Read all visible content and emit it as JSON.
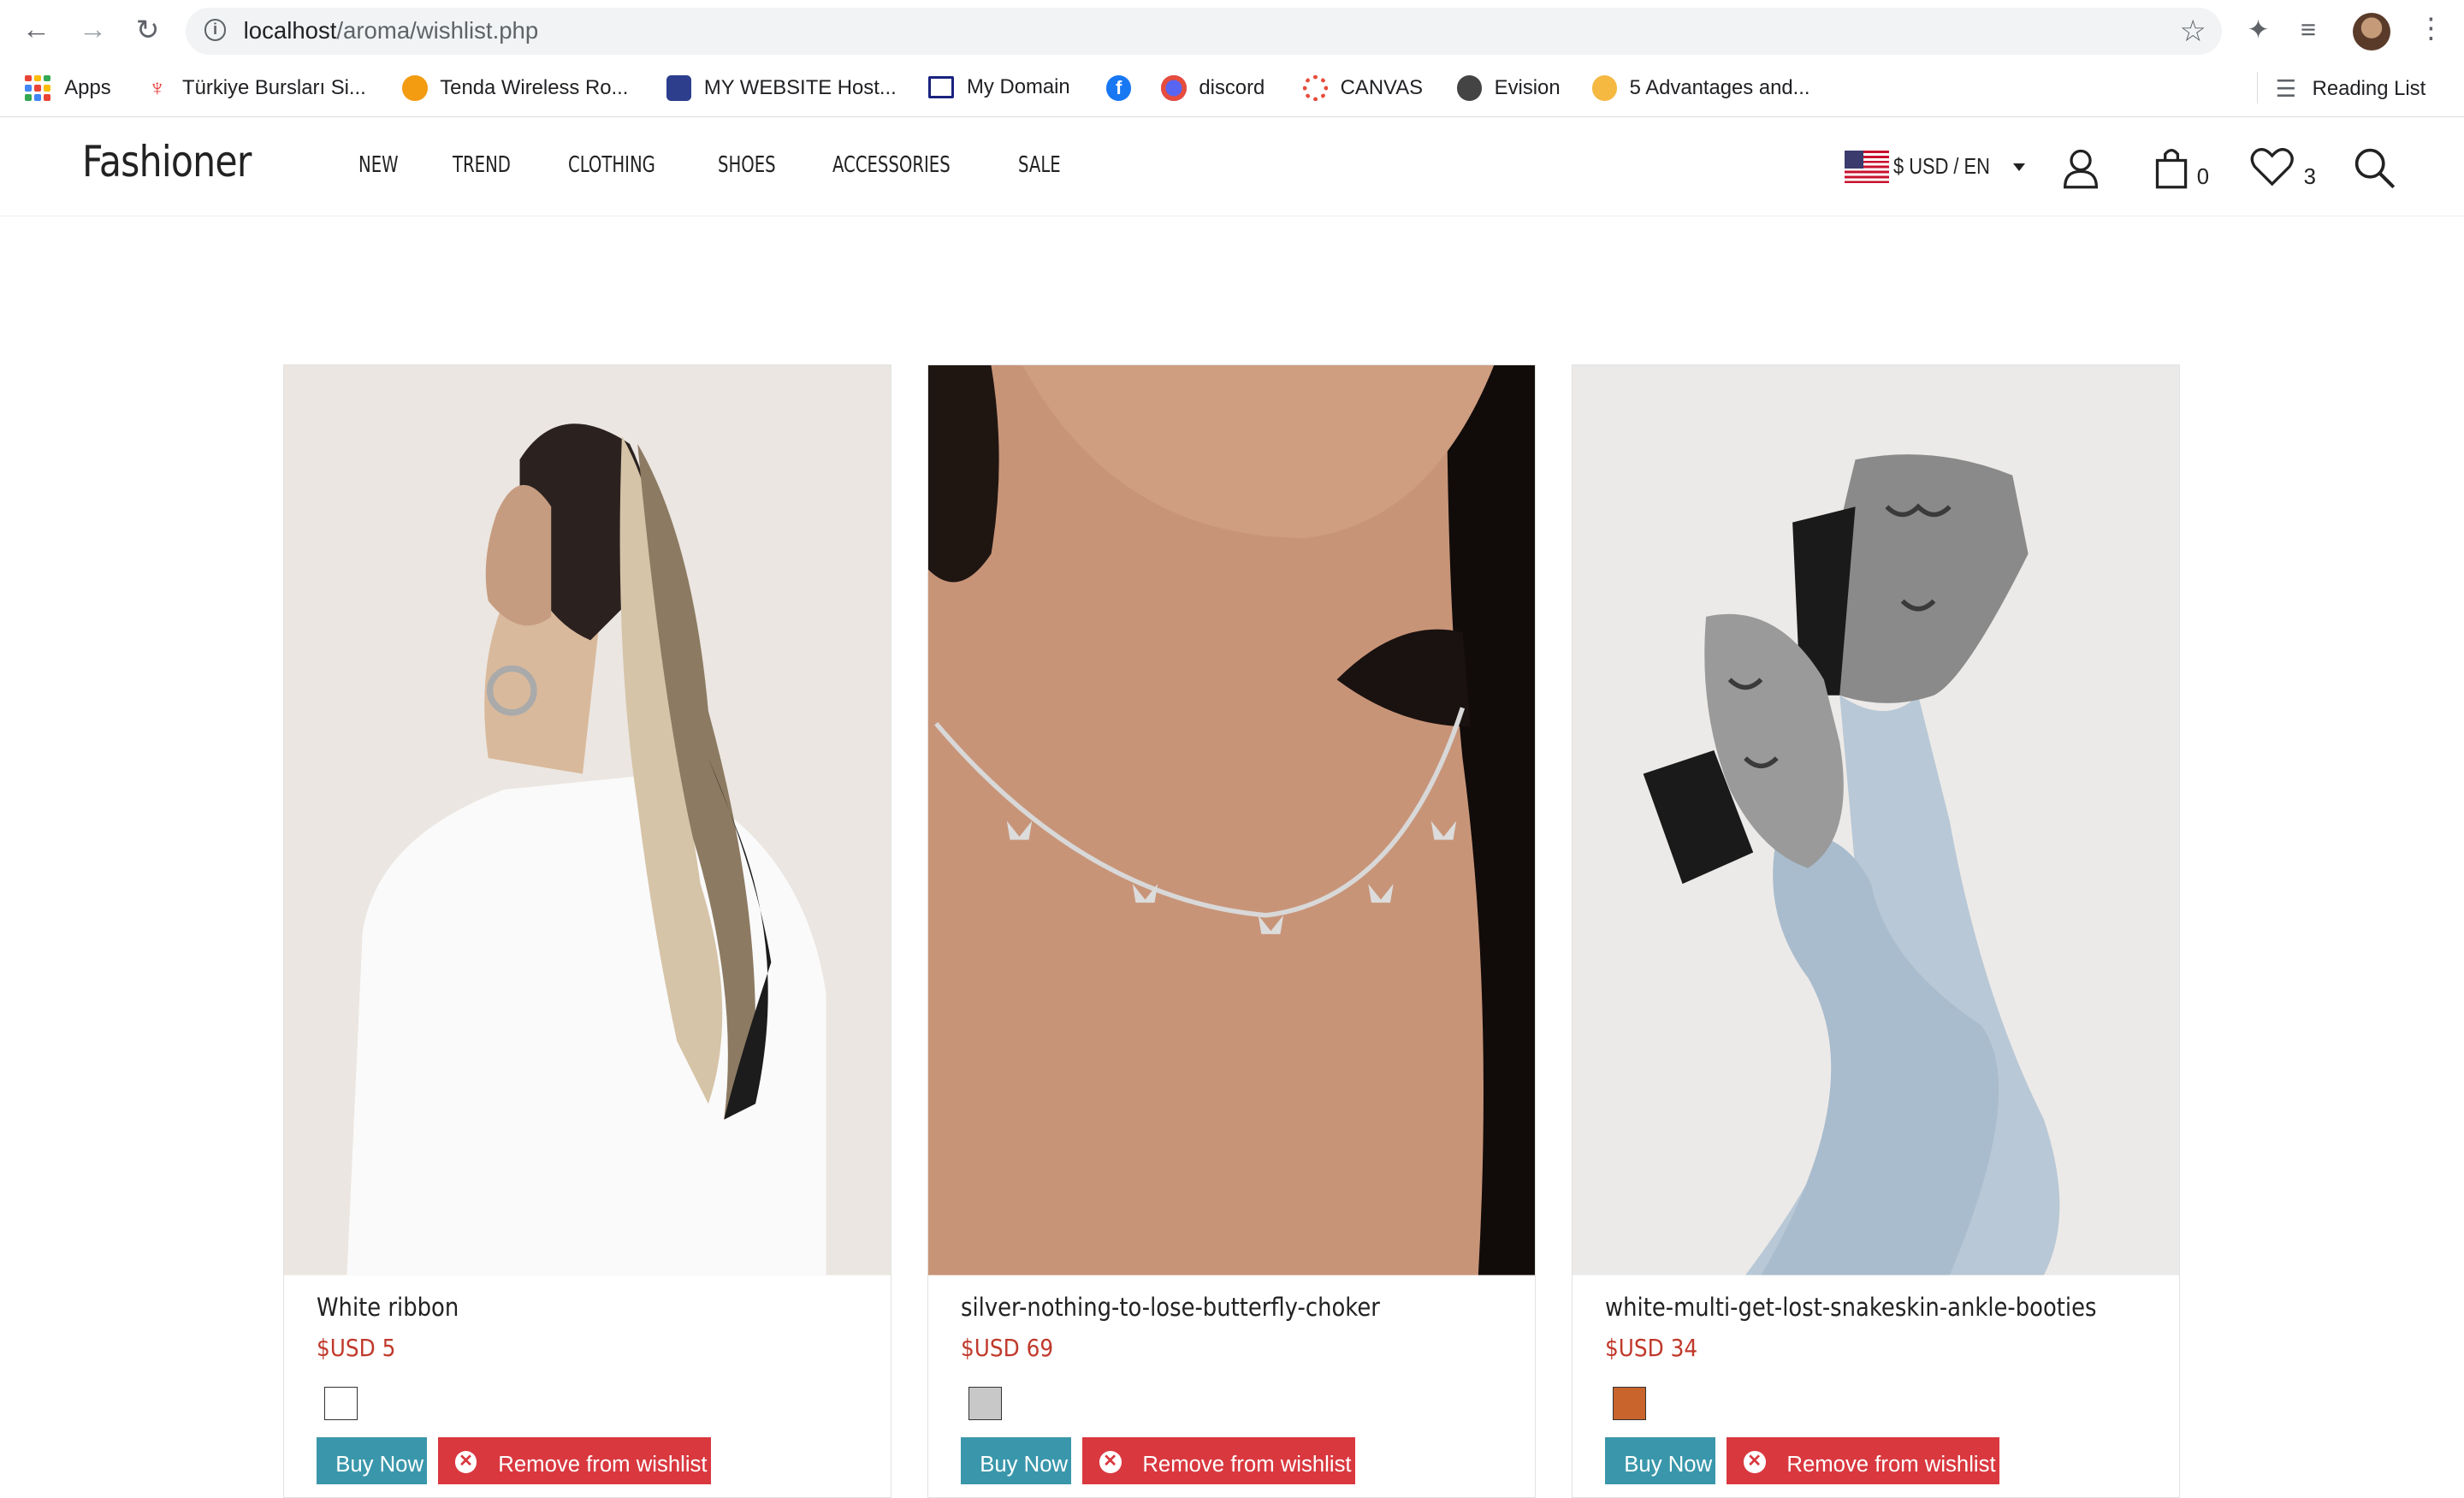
{
  "browser": {
    "url_host": "localhost",
    "url_path": "/aroma/wishlist.php",
    "bookmarks": [
      {
        "label": "Apps",
        "icon": "apps-grid-icon"
      },
      {
        "label": "Türkiye Bursları Si...",
        "icon": "tulip-icon"
      },
      {
        "label": "Tenda Wireless Ro...",
        "icon": "tenda-icon"
      },
      {
        "label": "MY WEBSITE Host...",
        "icon": "rocket-icon"
      },
      {
        "label": "My Domain",
        "icon": "window-icon"
      },
      {
        "label": "",
        "icon": "facebook-icon"
      },
      {
        "label": "discord",
        "icon": "discord-icon"
      },
      {
        "label": "CANVAS",
        "icon": "canvas-icon"
      },
      {
        "label": "Evision",
        "icon": "globe-icon"
      },
      {
        "label": "5 Advantages and...",
        "icon": "smiley-icon"
      }
    ],
    "reading_list": "Reading List"
  },
  "header": {
    "logo": "Fashioner",
    "menu": [
      "NEW",
      "TREND",
      "CLOTHING",
      "SHOES",
      "ACCESSORIES",
      "SALE"
    ],
    "currency": "$ USD / EN",
    "cart_count": "0",
    "wishlist_count": "3"
  },
  "products": [
    {
      "title": "White ribbon",
      "price": "$USD 5",
      "swatch": "#ffffff",
      "buy": "Buy Now",
      "remove": "Remove from wishlist"
    },
    {
      "title": "silver-nothing-to-lose-butterfly-choker",
      "price": "$USD 69",
      "swatch": "#c8c8c8",
      "buy": "Buy Now",
      "remove": "Remove from wishlist"
    },
    {
      "title": "white-multi-get-lost-snakeskin-ankle-booties",
      "price": "$USD 34",
      "swatch": "#c8642c",
      "buy": "Buy Now",
      "remove": "Remove from wishlist"
    }
  ],
  "colors": {
    "accent_price": "#c0392b",
    "buy_button": "#3a97ab",
    "remove_button": "#d9383f"
  }
}
